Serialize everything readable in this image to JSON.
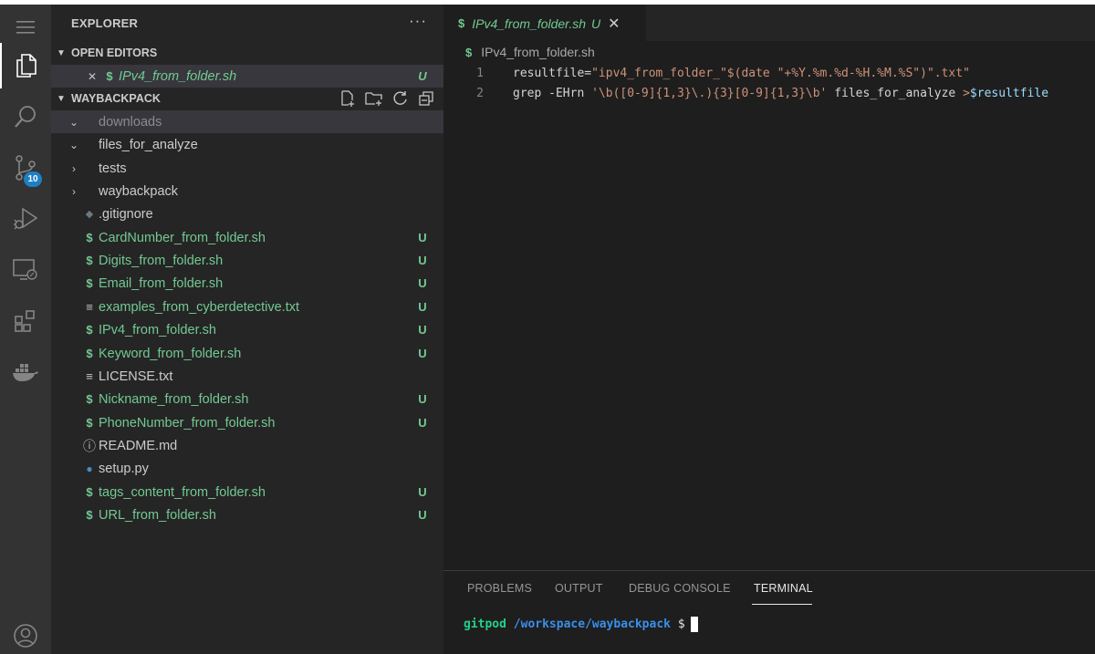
{
  "activity_bar": {
    "items": [
      {
        "name": "menu-icon"
      },
      {
        "name": "explorer-icon"
      },
      {
        "name": "search-icon"
      },
      {
        "name": "source-control-icon"
      },
      {
        "name": "run-debug-icon"
      },
      {
        "name": "remote-explorer-icon"
      },
      {
        "name": "extensions-icon"
      },
      {
        "name": "docker-icon"
      },
      {
        "name": "account-icon"
      }
    ],
    "source_control_badge": "10"
  },
  "sidebar": {
    "title": "EXPLORER",
    "more": "···",
    "open_editors": {
      "label": "OPEN EDITORS",
      "files": [
        {
          "close": "✕",
          "icon": "$",
          "name": "IPv4_from_folder.sh",
          "git": "U"
        }
      ]
    },
    "project": {
      "label": "WAYBACKPACK",
      "items": [
        {
          "arrow": "⌄",
          "icon": "",
          "name": "downloads",
          "git": "",
          "kind": "folder-open"
        },
        {
          "arrow": "⌄",
          "icon": "",
          "name": "files_for_analyze",
          "git": "",
          "kind": "folder-open"
        },
        {
          "arrow": "›",
          "icon": "",
          "name": "tests",
          "git": "",
          "kind": "folder"
        },
        {
          "arrow": "›",
          "icon": "",
          "name": "waybackpack",
          "git": "",
          "kind": "folder"
        },
        {
          "arrow": "",
          "icon": "◆",
          "name": ".gitignore",
          "git": "",
          "kind": "gitignore"
        },
        {
          "arrow": "",
          "icon": "$",
          "name": "CardNumber_from_folder.sh",
          "git": "U",
          "kind": "shell"
        },
        {
          "arrow": "",
          "icon": "$",
          "name": "Digits_from_folder.sh",
          "git": "U",
          "kind": "shell"
        },
        {
          "arrow": "",
          "icon": "$",
          "name": "Email_from_folder.sh",
          "git": "U",
          "kind": "shell"
        },
        {
          "arrow": "",
          "icon": "≡",
          "name": "examples_from_cyberdetective.txt",
          "git": "U",
          "kind": "text"
        },
        {
          "arrow": "",
          "icon": "$",
          "name": "IPv4_from_folder.sh",
          "git": "U",
          "kind": "shell"
        },
        {
          "arrow": "",
          "icon": "$",
          "name": "Keyword_from_folder.sh",
          "git": "U",
          "kind": "shell"
        },
        {
          "arrow": "",
          "icon": "≡",
          "name": "LICENSE.txt",
          "git": "",
          "kind": "text"
        },
        {
          "arrow": "",
          "icon": "$",
          "name": "Nickname_from_folder.sh",
          "git": "U",
          "kind": "shell"
        },
        {
          "arrow": "",
          "icon": "$",
          "name": "PhoneNumber_from_folder.sh",
          "git": "U",
          "kind": "shell"
        },
        {
          "arrow": "",
          "icon": "ⓘ",
          "name": "README.md",
          "git": "",
          "kind": "info"
        },
        {
          "arrow": "",
          "icon": "●",
          "name": "setup.py",
          "git": "",
          "kind": "python"
        },
        {
          "arrow": "",
          "icon": "$",
          "name": "tags_content_from_folder.sh",
          "git": "U",
          "kind": "shell"
        },
        {
          "arrow": "",
          "icon": "$",
          "name": "URL_from_folder.sh",
          "git": "U",
          "kind": "shell"
        }
      ]
    }
  },
  "editor": {
    "tab": {
      "icon": "$",
      "name": "IPv4_from_folder.sh",
      "git": "U",
      "close": "✕"
    },
    "breadcrumb": {
      "icon": "$",
      "name": "IPv4_from_folder.sh"
    },
    "lines": [
      {
        "num": "1",
        "tokens": [
          {
            "t": "resultfile=",
            "c": "kw"
          },
          {
            "t": "\"ipv4_from_folder_\"$(date \"+%Y.%m.%d-%H.%M.%S\")\".txt\"",
            "c": "s"
          }
        ]
      },
      {
        "num": "2",
        "tokens": [
          {
            "t": "grep -EHrn ",
            "c": "kw"
          },
          {
            "t": "'\\b([0-9]{1,3}\\.){3}[0-9]{1,3}\\b'",
            "c": "s"
          },
          {
            "t": " files_for_analyze ",
            "c": "kw"
          },
          {
            "t": ">",
            "c": "op"
          },
          {
            "t": "$resultfile",
            "c": "var"
          }
        ]
      }
    ]
  },
  "panel": {
    "tabs": [
      "PROBLEMS",
      "OUTPUT",
      "DEBUG CONSOLE",
      "TERMINAL"
    ],
    "active_tab": "TERMINAL",
    "terminal": {
      "user": "gitpod",
      "path": "/workspace/waybackpack",
      "prompt": "$"
    }
  },
  "colors": {
    "activity_bar": "#333333",
    "sidebar": "#252526",
    "editor": "#1e1e1e",
    "untracked_green": "#73c991",
    "badge_blue": "#1e7fc4"
  }
}
